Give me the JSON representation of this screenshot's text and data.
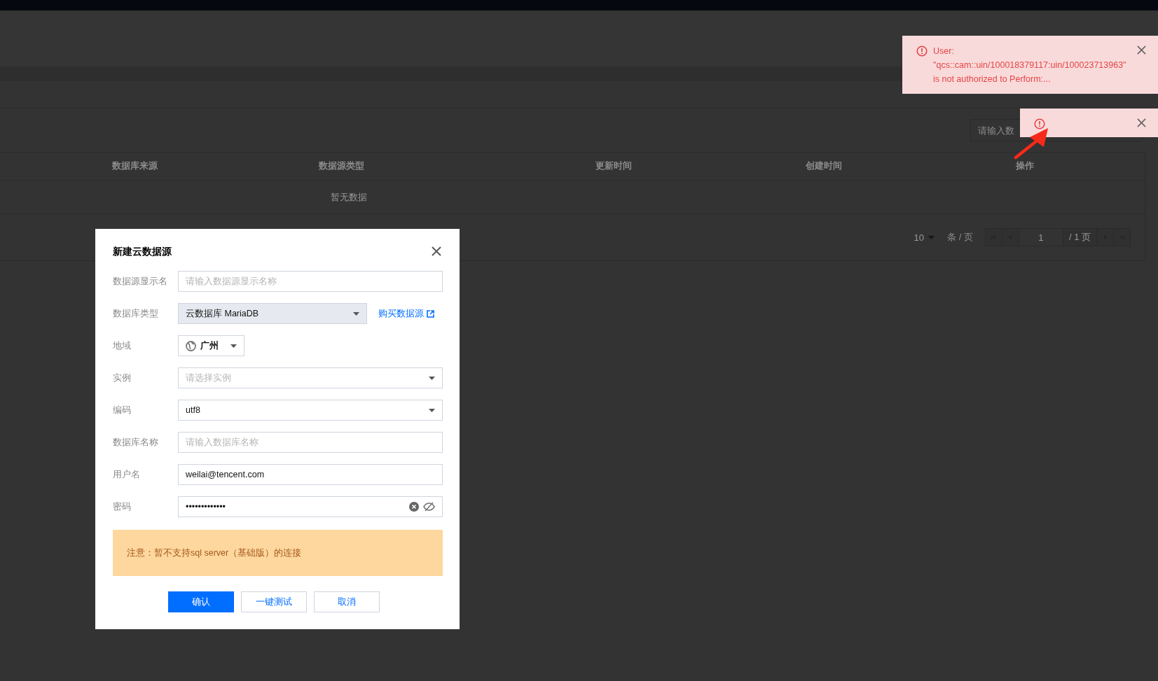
{
  "search": {
    "placeholder": "请输入数"
  },
  "table": {
    "columns": [
      "数据库来源",
      "数据源类型",
      "更新时间",
      "创建时间",
      "操作"
    ],
    "empty_text": "暂无数据"
  },
  "pagination": {
    "page_size": "10",
    "page_size_unit": "条 / 页",
    "page": "1",
    "total": "/ 1 页"
  },
  "dialog": {
    "title": "新建云数据源",
    "fields": [
      {
        "kind": "input",
        "label": "数据源显示名",
        "placeholder": "请输入数据源显示名称",
        "disabled": false
      },
      {
        "kind": "select",
        "label": "数据库类型",
        "value": "云数据库 MariaDB",
        "disabled": true,
        "link": "购买数据源"
      },
      {
        "kind": "region",
        "label": "地域",
        "value": "广州",
        "disabled": false
      },
      {
        "kind": "select",
        "label": "实例",
        "placeholder": "请选择实例",
        "disabled": false
      },
      {
        "kind": "select",
        "label": "编码",
        "value": "utf8",
        "disabled": false
      },
      {
        "kind": "input",
        "label": "数据库名称",
        "placeholder": "请输入数据库名称",
        "disabled": false
      },
      {
        "kind": "input",
        "label": "用户名",
        "value": "weilai@tencent.com",
        "disabled": false
      },
      {
        "kind": "password",
        "label": "密码",
        "value": "•••••••••••••",
        "disabled": false
      }
    ],
    "notice": "注意：暂不支持sql server（基础版）的连接",
    "buttons": [
      {
        "kind": "primary",
        "label": "确认"
      },
      {
        "kind": "default",
        "label": "一键测试"
      },
      {
        "kind": "default",
        "label": "取消"
      }
    ]
  },
  "toasts": [
    {
      "kind": "error",
      "message_lines": [
        "User:",
        "\"qcs::cam::uin/100018379117:uin/100023713963\"",
        "is not authorized to Perform:..."
      ]
    },
    {
      "kind": "error"
    }
  ]
}
